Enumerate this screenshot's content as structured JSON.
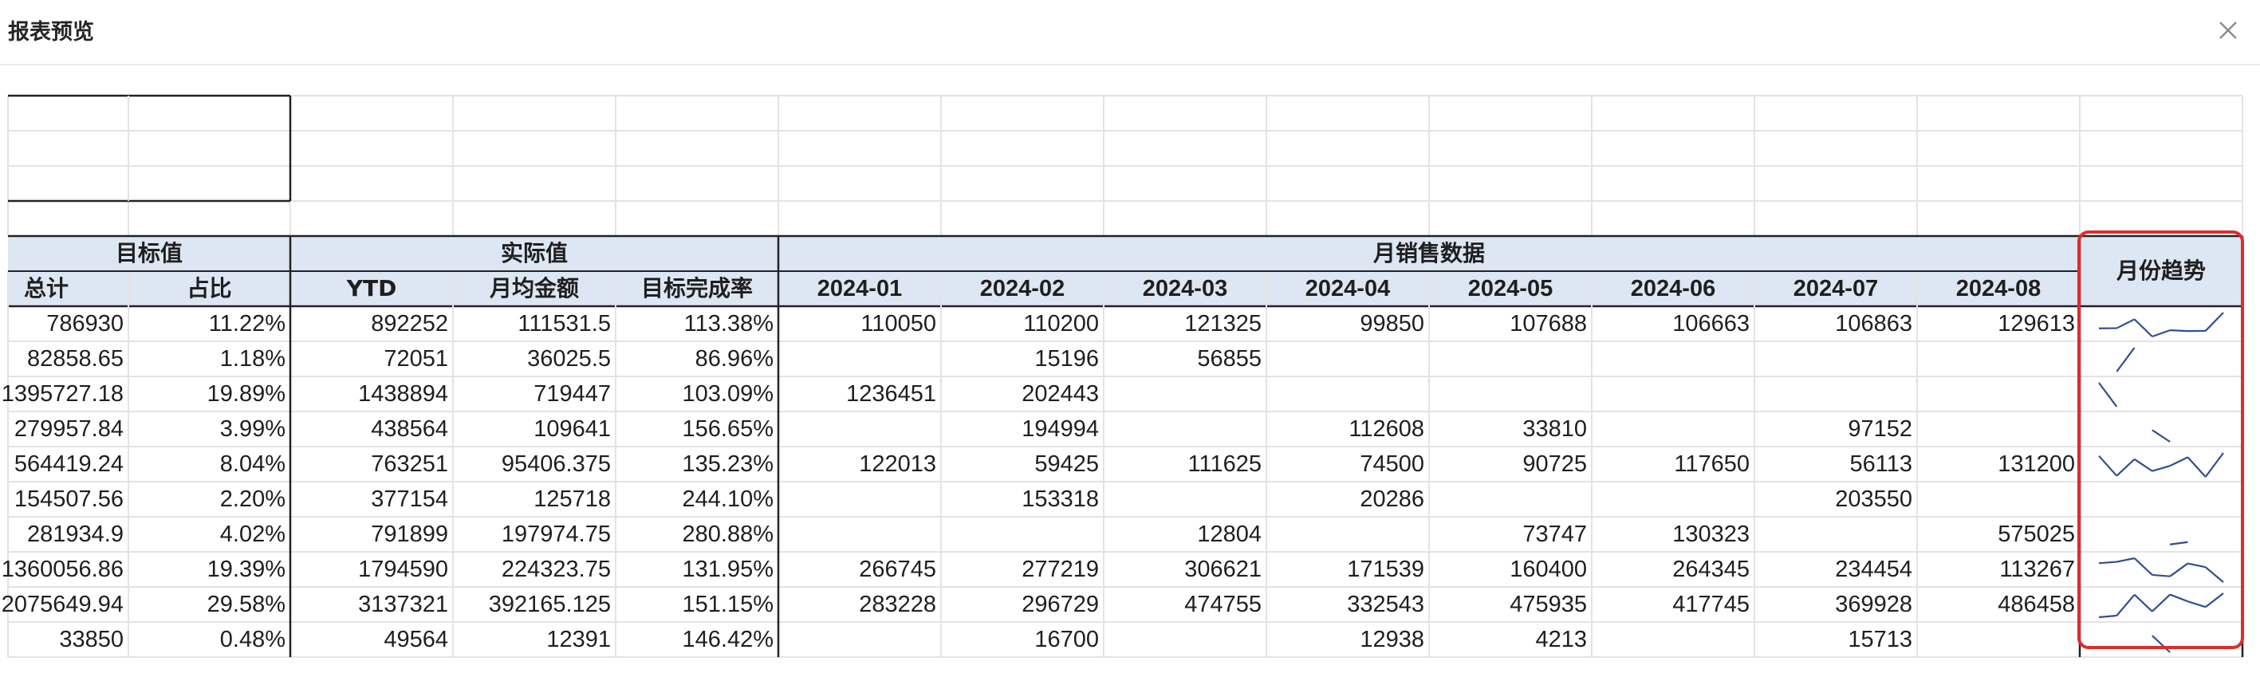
{
  "dialog": {
    "title": "报表预览",
    "close_icon": "close-icon"
  },
  "colors": {
    "header_fill": "#dde6f3",
    "trend_line": "#2f4f8f",
    "highlight": "#e02b2b",
    "grid": "#e3e3e3",
    "border": "#222222"
  },
  "groups": {
    "target": "目标值",
    "actual": "实际值",
    "monthly": "月销售数据",
    "trend": "月份趋势"
  },
  "columns": [
    "总计",
    "占比",
    "YTD",
    "月均金额",
    "目标完成率",
    "2024-01",
    "2024-02",
    "2024-03",
    "2024-04",
    "2024-05",
    "2024-06",
    "2024-07",
    "2024-08"
  ],
  "rows": [
    {
      "total": "786930",
      "share": "11.22%",
      "ytd": "892252",
      "avg": "111531.5",
      "rate": "113.38%",
      "months": [
        "110050",
        "110200",
        "121325",
        "99850",
        "107688",
        "106663",
        "106863",
        "129613"
      ]
    },
    {
      "total": "82858.65",
      "share": "1.18%",
      "ytd": "72051",
      "avg": "36025.5",
      "rate": "86.96%",
      "months": [
        "",
        "15196",
        "56855",
        "",
        "",
        "",
        "",
        ""
      ]
    },
    {
      "total": "1395727.18",
      "share": "19.89%",
      "ytd": "1438894",
      "avg": "719447",
      "rate": "103.09%",
      "months": [
        "1236451",
        "202443",
        "",
        "",
        "",
        "",
        "",
        ""
      ]
    },
    {
      "total": "279957.84",
      "share": "3.99%",
      "ytd": "438564",
      "avg": "109641",
      "rate": "156.65%",
      "months": [
        "",
        "194994",
        "",
        "112608",
        "33810",
        "",
        "97152",
        ""
      ]
    },
    {
      "total": "564419.24",
      "share": "8.04%",
      "ytd": "763251",
      "avg": "95406.375",
      "rate": "135.23%",
      "months": [
        "122013",
        "59425",
        "111625",
        "74500",
        "90725",
        "117650",
        "56113",
        "131200"
      ]
    },
    {
      "total": "154507.56",
      "share": "2.20%",
      "ytd": "377154",
      "avg": "125718",
      "rate": "244.10%",
      "months": [
        "",
        "153318",
        "",
        "20286",
        "",
        "",
        "203550",
        ""
      ]
    },
    {
      "total": "281934.9",
      "share": "4.02%",
      "ytd": "791899",
      "avg": "197974.75",
      "rate": "280.88%",
      "months": [
        "",
        "",
        "12804",
        "",
        "73747",
        "130323",
        "",
        "575025"
      ]
    },
    {
      "total": "1360056.86",
      "share": "19.39%",
      "ytd": "1794590",
      "avg": "224323.75",
      "rate": "131.95%",
      "months": [
        "266745",
        "277219",
        "306621",
        "171539",
        "160400",
        "264345",
        "234454",
        "113267"
      ]
    },
    {
      "total": "2075649.94",
      "share": "29.58%",
      "ytd": "3137321",
      "avg": "392165.125",
      "rate": "151.15%",
      "months": [
        "283228",
        "296729",
        "474755",
        "332543",
        "475935",
        "417745",
        "369928",
        "486458"
      ]
    },
    {
      "total": "33850",
      "share": "0.48%",
      "ytd": "49564",
      "avg": "12391",
      "rate": "146.42%",
      "months": [
        "",
        "16700",
        "",
        "12938",
        "4213",
        "",
        "15713",
        ""
      ]
    }
  ]
}
